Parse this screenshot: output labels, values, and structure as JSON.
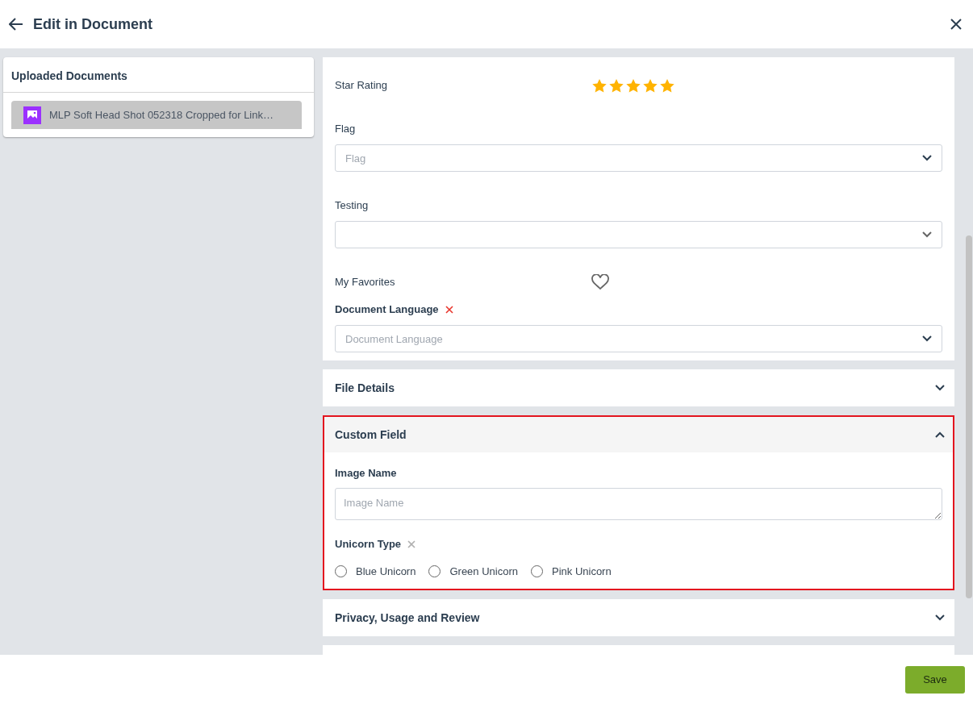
{
  "header": {
    "title": "Edit in Document"
  },
  "documents_panel": {
    "title": "Uploaded Documents",
    "items": [
      {
        "name": "MLP Soft Head Shot 052318 Cropped for Link…",
        "selected": true
      }
    ]
  },
  "form": {
    "fields": [
      {
        "kind": "stars",
        "label": "Star Rating",
        "stars": 5
      },
      {
        "kind": "select",
        "label": "Flag",
        "placeholder": "Flag"
      },
      {
        "kind": "select",
        "label": "Testing"
      },
      {
        "kind": "favorite",
        "label": "My Favorites",
        "on": false
      },
      {
        "kind": "select",
        "label": "Document Language",
        "placeholder": "Document Language",
        "invalid": true
      }
    ]
  },
  "sections": [
    {
      "title": "File Details",
      "expanded": false
    },
    {
      "title": "Custom Field",
      "expanded": true,
      "highlighted": true,
      "fields": [
        {
          "kind": "textarea",
          "label": "Image Name",
          "placeholder": "Image Name"
        },
        {
          "kind": "radio",
          "label": "Unicorn Type",
          "clearable": true,
          "options": [
            {
              "label": "Blue Unicorn",
              "selected": false
            },
            {
              "label": "Green Unicorn",
              "selected": false
            },
            {
              "label": "Pink Unicorn",
              "selected": false
            }
          ]
        }
      ]
    },
    {
      "title": "Privacy, Usage and Review",
      "expanded": false
    }
  ],
  "footer": {
    "save_label": "Save"
  }
}
